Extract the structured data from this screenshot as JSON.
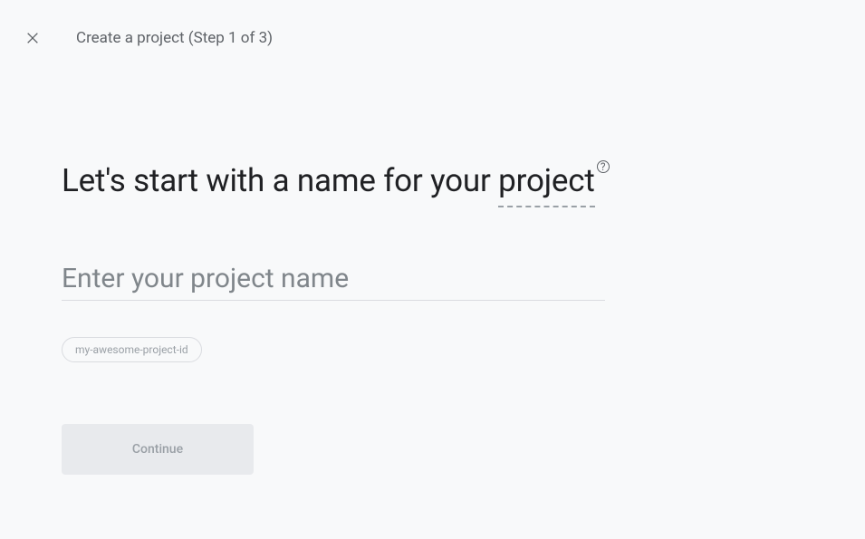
{
  "header": {
    "title": "Create a project (Step 1 of 3)"
  },
  "main": {
    "heading_prefix": "Let's start with a name for your ",
    "heading_underlined": "project",
    "input_placeholder": "Enter your project name",
    "input_value": "",
    "chip_label": "my-awesome-project-id",
    "continue_label": "Continue"
  }
}
